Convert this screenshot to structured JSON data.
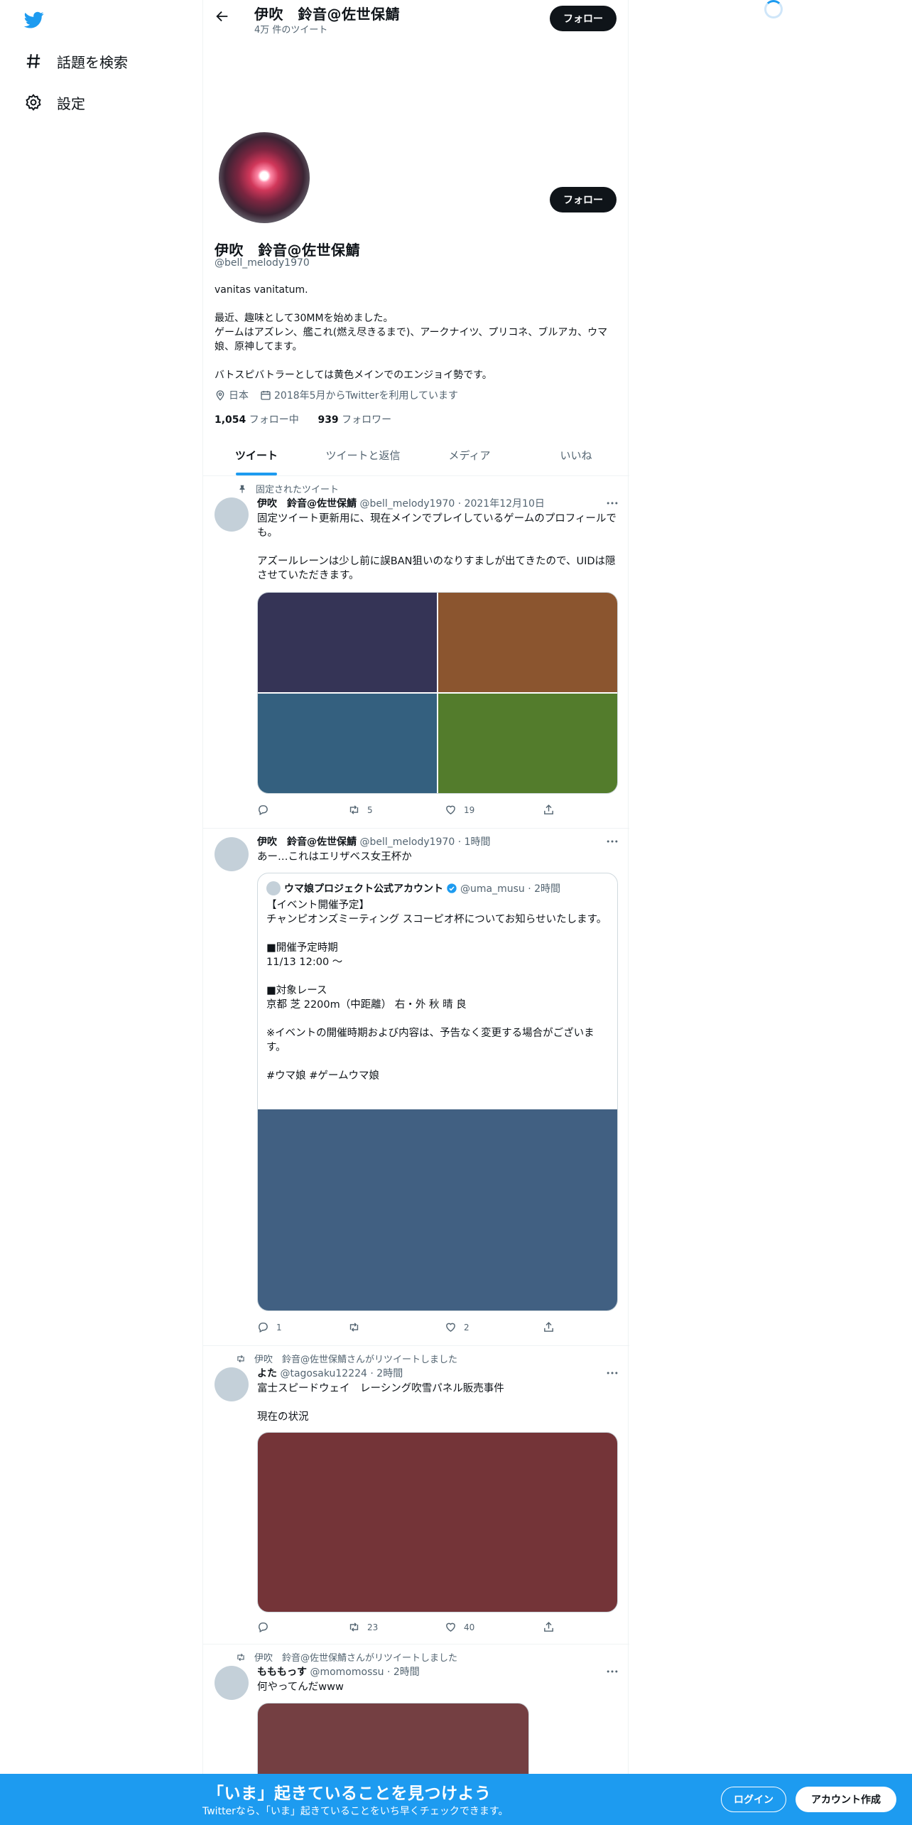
{
  "nav": {
    "items": [
      {
        "label": "話題を検索",
        "icon": "hashtag-icon"
      },
      {
        "label": "設定",
        "icon": "gear-icon"
      }
    ]
  },
  "header": {
    "name": "伊吹　鈴音@佐世保鯖",
    "tweet_count": "4万 件のツイート",
    "follow_label": "フォロー"
  },
  "profile": {
    "name": "伊吹　鈴音@佐世保鯖",
    "handle": "@bell_melody1970",
    "follow_label": "フォロー",
    "bio": "vanitas vanitatum.\n\n最近、趣味として30MMを始めました。\nゲームはアズレン、艦これ(燃え尽きるまで)、アークナイツ、プリコネ、ブルアカ、ウマ娘、原神してます。\n\nバトスピバトラーとしては黄色メインでのエンジョイ勢です。",
    "location": "日本",
    "joined": "2018年5月からTwitterを利用しています",
    "following_count": "1,054",
    "following_label": "フォロー中",
    "followers_count": "939",
    "followers_label": "フォロワー"
  },
  "tabs": [
    "ツイート",
    "ツイートと返信",
    "メディア",
    "いいね"
  ],
  "tweets": [
    {
      "context": "固定されたツイート",
      "name": "伊吹　鈴音@佐世保鯖",
      "meta": "@bell_melody1970 · 2021年12月10日",
      "text": "固定ツイート更新用に、現在メインでプレイしているゲームのプロフィールでも。\n\nアズールレーンは少し前に誤BAN狙いのなりすましが出てきたので、UIDは隠させていただきます。",
      "media_colors": [
        "#353456",
        "#8b552f",
        "#34607f",
        "#537c2c"
      ],
      "replies": "",
      "retweets": "5",
      "likes": "19"
    },
    {
      "name": "伊吹　鈴音@佐世保鯖",
      "meta": "@bell_melody1970 · 1時間",
      "text": "あー…これはエリザベス女王杯か",
      "quote": {
        "name": "ウマ娘プロジェクト公式アカウント",
        "meta": "@uma_musu · 2時間",
        "text": "【イベント開催予定】\nチャンピオンズミーティング スコーピオ杯についてお知らせいたします。\n\n■開催予定時期\n11/13 12:00 ～\n\n■対象レース\n京都 芝 2200m（中距離） 右・外 秋 晴 良\n\n※イベントの開催時期および内容は、予告なく変更する場合がございます。\n\n#ウマ娘 #ゲームウマ娘",
        "media_color": "#416082"
      },
      "replies": "1",
      "retweets": "",
      "likes": "2"
    },
    {
      "context": "伊吹　鈴音@佐世保鯖さんがリツイートしました",
      "name": "よた",
      "meta": "@tagosaku12224 · 2時間",
      "text": "富士スピードウェイ　レーシング吹雪パネル販売事件\n\n現在の状況",
      "media_color": "#743438",
      "replies": "",
      "retweets": "23",
      "likes": "40"
    },
    {
      "context": "伊吹　鈴音@佐世保鯖さんがリツイートしました",
      "name": "もももっす",
      "meta": "@momomossu · 2時間",
      "text": "何やってんだwww",
      "media_color": "#743f42"
    }
  ],
  "bottom": {
    "title": "「いま」起きていることを見つけよう",
    "subtitle": "Twitterなら、「いま」起きていることをいち早くチェックできます。",
    "login": "ログイン",
    "signup": "アカウント作成"
  },
  "colors": {
    "accent": "#1d9bf0",
    "text": "#0f1419",
    "muted": "#536471"
  }
}
